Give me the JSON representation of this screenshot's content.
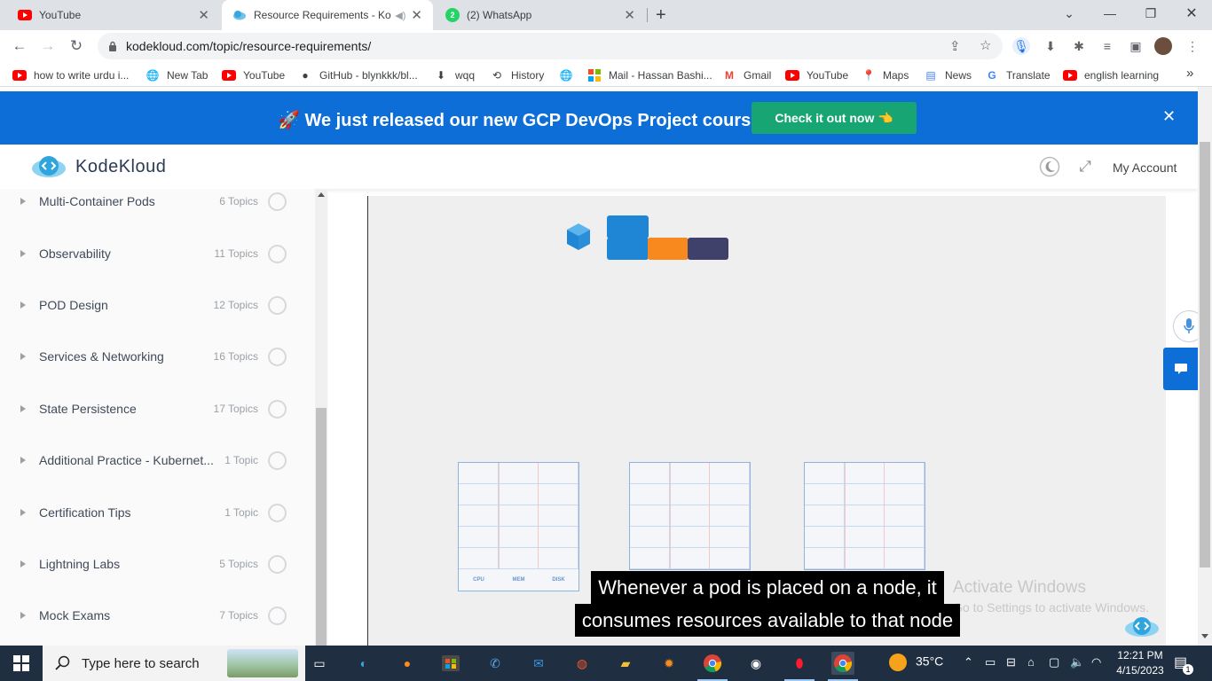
{
  "browser": {
    "tabs": [
      {
        "title": "YouTube",
        "icon": "youtube-icon",
        "active": false
      },
      {
        "title": "Resource Requirements - Ko",
        "icon": "kodekloud-icon",
        "active": true
      },
      {
        "title": "(2) WhatsApp",
        "icon": "whatsapp-icon",
        "active": false
      }
    ],
    "new_tab_label": "+",
    "url": "kodekloud.com/topic/resource-requirements/",
    "bookmarks": [
      {
        "label": "how to write urdu i...",
        "icon": "youtube-icon"
      },
      {
        "label": "New Tab",
        "icon": "globe-icon"
      },
      {
        "label": "YouTube",
        "icon": "youtube-icon"
      },
      {
        "label": "GitHub - blynkkk/bl...",
        "icon": "github-icon"
      },
      {
        "label": "wqq",
        "icon": "download-icon"
      },
      {
        "label": "History",
        "icon": "history-icon"
      },
      {
        "label": "",
        "icon": "globe-icon"
      },
      {
        "label": "Mail - Hassan Bashi...",
        "icon": "microsoft-icon"
      },
      {
        "label": "Gmail",
        "icon": "gmail-icon"
      },
      {
        "label": "YouTube",
        "icon": "youtube-icon"
      },
      {
        "label": "Maps",
        "icon": "maps-icon"
      },
      {
        "label": "News",
        "icon": "news-icon"
      },
      {
        "label": "Translate",
        "icon": "translate-icon"
      },
      {
        "label": "english learning",
        "icon": "youtube-icon"
      }
    ],
    "overflow_label": "»"
  },
  "promo": {
    "emoji": "🚀",
    "text": "We just released our new GCP DevOps Project course",
    "button": "Check it out now 👈",
    "close": "✕"
  },
  "header": {
    "brand": "KodeKloud",
    "account": "My Account"
  },
  "sidebar": {
    "modules": [
      {
        "title": "Multi-Container Pods",
        "count": "6 Topics"
      },
      {
        "title": "Observability",
        "count": "11 Topics"
      },
      {
        "title": "POD Design",
        "count": "12 Topics"
      },
      {
        "title": "Services & Networking",
        "count": "16 Topics"
      },
      {
        "title": "State Persistence",
        "count": "17 Topics"
      },
      {
        "title": "Additional Practice - Kubernet...",
        "count": "1 Topic"
      },
      {
        "title": "Certification Tips",
        "count": "1 Topic"
      },
      {
        "title": "Lightning Labs",
        "count": "5 Topics"
      },
      {
        "title": "Mock Exams",
        "count": "7 Topics"
      }
    ]
  },
  "video": {
    "grid_labels": [
      "CPU",
      "MEM",
      "DISK"
    ],
    "caption_line1": "Whenever a pod is placed on a node, it",
    "caption_line2": "consumes resources available to that node",
    "watermark_line1": "Activate Windows",
    "watermark_line2": "Go to Settings to activate Windows.",
    "colors": {
      "block_blue": "#1f86d6",
      "block_orange": "#f7891f",
      "block_navy": "#3f416b",
      "cube": "#2a8fd8"
    }
  },
  "taskbar": {
    "search_placeholder": "Type here to search",
    "weather": "35°C",
    "time": "12:21 PM",
    "date": "4/15/2023",
    "notification_count": "1"
  },
  "colors": {
    "brand_blue": "#0d6ed8",
    "promo_button": "#17a673",
    "taskbar": "#1f2e40"
  }
}
